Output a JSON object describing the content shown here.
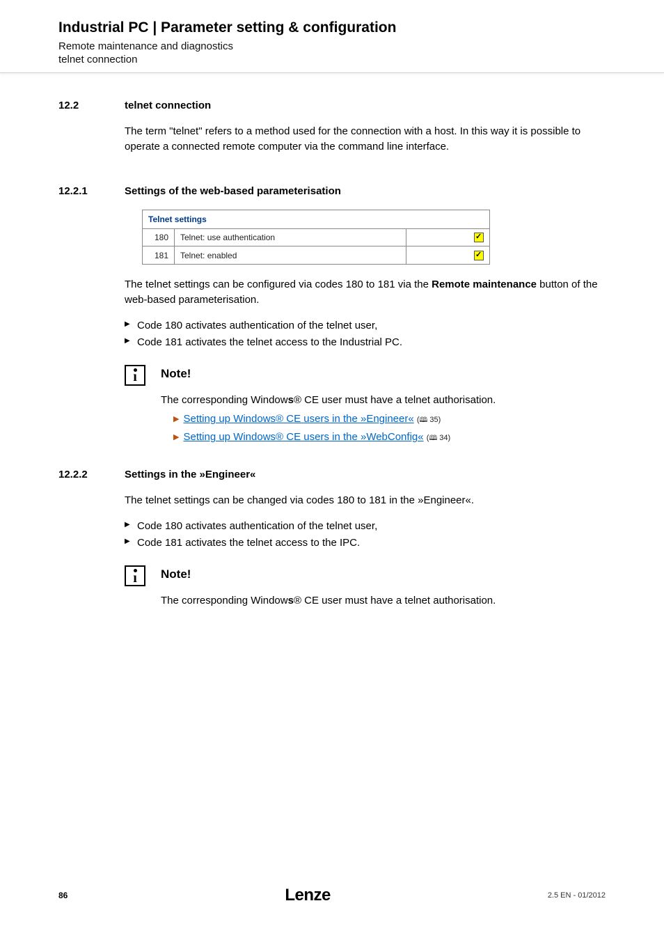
{
  "header": {
    "title": "Industrial PC | Parameter setting & configuration",
    "sub1": "Remote maintenance and diagnostics",
    "sub2": "telnet connection"
  },
  "sec12_2": {
    "num": "12.2",
    "title": "telnet connection",
    "intro": "The term \"telnet\" refers to a method used for the connection with a host. In this way it is possible to operate a connected remote computer via the command line interface."
  },
  "sec12_2_1": {
    "num": "12.2.1",
    "title": "Settings of the web-based parameterisation",
    "table": {
      "header": "Telnet settings",
      "rows": [
        {
          "code": "180",
          "label": "Telnet: use authentication",
          "checked": true
        },
        {
          "code": "181",
          "label": "Telnet: enabled",
          "checked": true
        }
      ]
    },
    "para_before": "The telnet settings can be configured via codes 180 to 181 via the ",
    "para_bold": "Remote maintenance",
    "para_after": " button of the web-based parameterisation.",
    "bullets": [
      "Code 180 activates authentication of the telnet user,",
      "Code 181 activates the telnet access to the Industrial PC."
    ],
    "note": {
      "title": "Note!",
      "body_before": "The corresponding Window",
      "body_bold": "s",
      "body_reg": "®",
      "body_after": " CE user must have a telnet authorisation.",
      "links": [
        {
          "text": "Setting up Windows® CE users in the »Engineer«",
          "pg": "35"
        },
        {
          "text": "Setting up Windows® CE users in the »WebConfig«",
          "pg": "34"
        }
      ]
    }
  },
  "sec12_2_2": {
    "num": "12.2.2",
    "title": "Settings in the »Engineer«",
    "intro": "The telnet settings can be changed via codes 180 to 181 in the »Engineer«.",
    "bullets": [
      "Code 180 activates authentication of the telnet user,",
      "Code 181 activates the telnet access to the IPC."
    ],
    "note": {
      "title": "Note!",
      "body_before": "The corresponding Window",
      "body_bold": "s",
      "body_reg": "®",
      "body_after": " CE user must have a telnet authorisation."
    }
  },
  "footer": {
    "page": "86",
    "brand": "Lenze",
    "version": "2.5 EN - 01/2012"
  }
}
